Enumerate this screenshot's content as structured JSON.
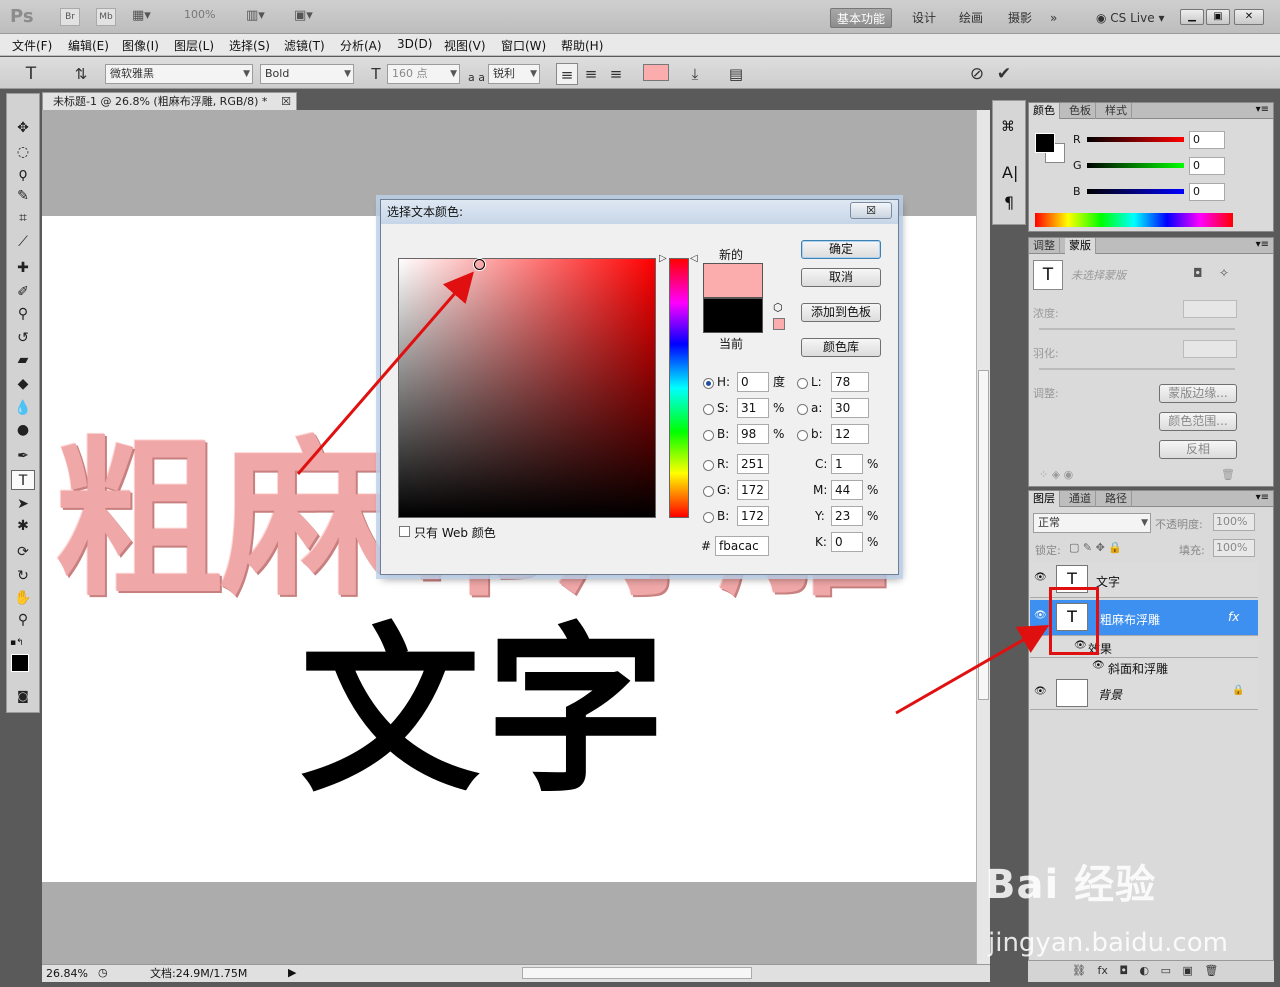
{
  "app": {
    "logo": "Ps",
    "bridge": "Br",
    "minibridge": "Mb",
    "zoom_menu": "100%",
    "workspaces": [
      "基本功能",
      "设计",
      "绘画",
      "摄影"
    ],
    "more": "»",
    "cslive": "CS Live"
  },
  "menu": [
    "文件(F)",
    "编辑(E)",
    "图像(I)",
    "图层(L)",
    "选择(S)",
    "滤镜(T)",
    "分析(A)",
    "3D(D)",
    "视图(V)",
    "窗口(W)",
    "帮助(H)"
  ],
  "options": {
    "font_family": "微软雅黑",
    "font_style": "Bold",
    "font_size": "160 点",
    "aa_label": "a a",
    "antialias": "锐利",
    "color_swatch": "#fbacac"
  },
  "document": {
    "tab_title": "未标题-1 @ 26.8% (粗麻布浮雕, RGB/8) *",
    "pink_text": "粗麻布浮雕",
    "black_text": "文字",
    "zoom": "26.84%",
    "doc_info": "文档:24.9M/1.75M"
  },
  "dialog": {
    "title": "选择文本颜色:",
    "close": "☒",
    "new_label": "新的",
    "current_label": "当前",
    "new_color": "#fbacac",
    "current_color": "#000000",
    "ok": "确定",
    "cancel": "取消",
    "add_swatch": "添加到色板",
    "color_library": "颜色库",
    "web_only": "只有 Web 颜色",
    "fields": {
      "H": "0",
      "S": "31",
      "B": "98",
      "R": "251",
      "G": "172",
      "B2": "172",
      "L": "78",
      "a": "30",
      "b": "12",
      "C": "1",
      "M": "44",
      "Y": "23",
      "K": "0",
      "hex": "fbacac"
    },
    "units": {
      "deg": "度",
      "pct": "%"
    }
  },
  "color_panel": {
    "tabs": [
      "颜色",
      "色板",
      "样式"
    ],
    "R": "0",
    "G": "0",
    "B": "0"
  },
  "adjust_panel": {
    "tabs": [
      "调整",
      "蒙版"
    ],
    "no_mask": "未选择蒙版",
    "density": "浓度:",
    "feather": "羽化:",
    "refine": "调整:",
    "mask_edge": "蒙版边缘...",
    "color_range": "颜色范围...",
    "invert": "反相"
  },
  "layers_panel": {
    "tabs": [
      "图层",
      "通道",
      "路径"
    ],
    "blend_mode": "正常",
    "opacity_label": "不透明度:",
    "opacity": "100%",
    "lock_label": "锁定:",
    "fill_label": "填充:",
    "fill": "100%",
    "layers": [
      {
        "name": "文字",
        "thumb": "T"
      },
      {
        "name": "粗麻布浮雕",
        "thumb": "T",
        "fx": "fx"
      },
      {
        "name": "效果"
      },
      {
        "name": "斜面和浮雕"
      },
      {
        "name": "背景"
      }
    ]
  },
  "watermark": {
    "main": "Bai 经验",
    "sub": "jingyan.baidu.com"
  }
}
